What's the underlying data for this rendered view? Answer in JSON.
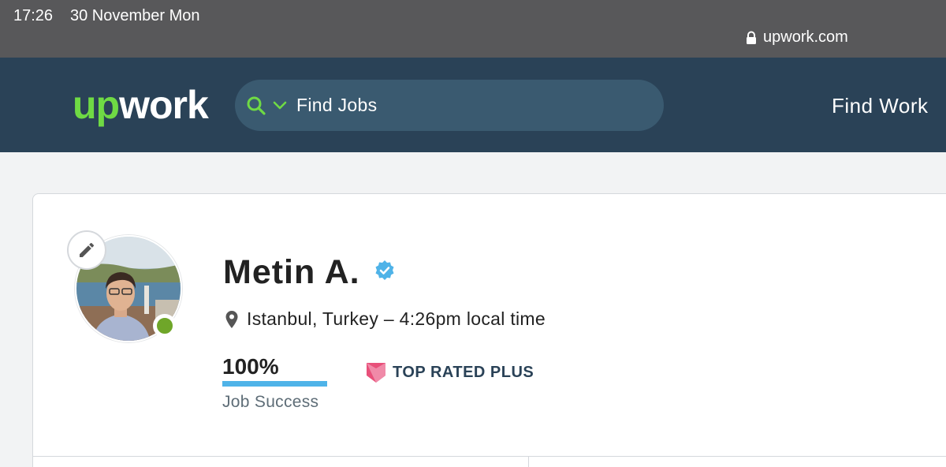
{
  "status_bar": {
    "time": "17:26",
    "date": "30 November Mon",
    "url": "upwork.com"
  },
  "header": {
    "logo_up": "up",
    "logo_work": "work",
    "search_label": "Find Jobs",
    "nav_find_work": "Find Work"
  },
  "profile": {
    "name": "Metin A.",
    "location": "Istanbul, Turkey – 4:26pm local time",
    "job_success_value": "100%",
    "job_success_percent": 100,
    "job_success_label": "Job Success",
    "badge_label": "TOP RATED PLUS"
  },
  "colors": {
    "brand_green": "#6fda44",
    "header_bg": "#2a4257",
    "progress_blue": "#4fb3e8",
    "online_green": "#6fa629",
    "badge_pink": "#e8507a"
  }
}
